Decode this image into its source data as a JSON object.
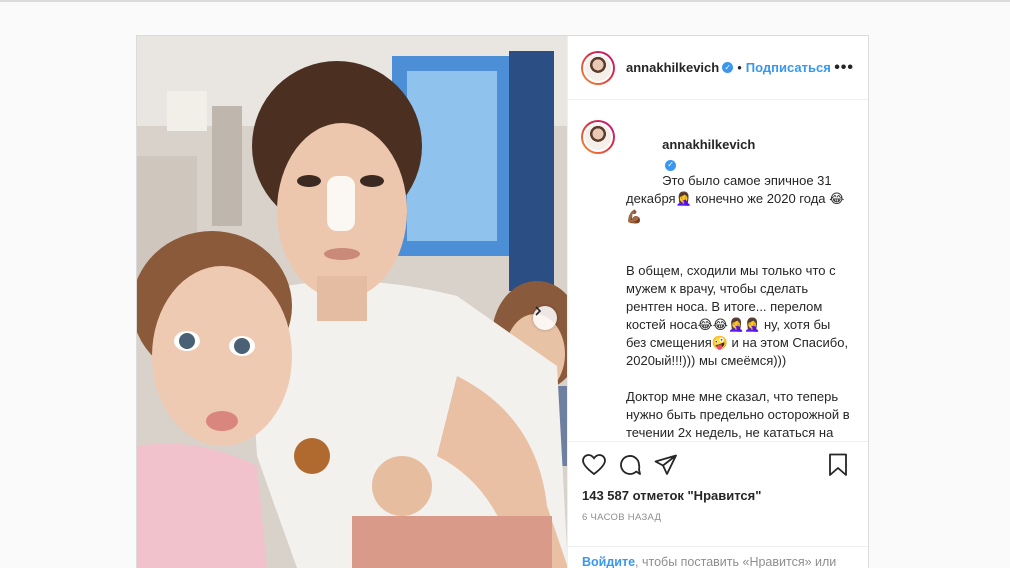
{
  "post": {
    "username": "annakhilkevich",
    "follow_label": "Подписаться",
    "more_label": "•••",
    "separator": "•",
    "caption_lines": [
      "Это было самое эпичное 31 декабря🤦‍♀️ конечно же 2020 года 😂💪🏾",
      "",
      "В общем, сходили мы только что с мужем к врачу, чтобы сделать рентген носа. В итоге... перелом костей носа😂😂🤦‍♀️🤦‍♀️ ну, хотя бы без смещения🤪 и на этом Спасибо, 2020ый!!!))) мы смеёмся)))",
      "",
      "Доктор мне мне сказал, что теперь нужно быть предельно осторожной в течении 2х недель, не кататься на коньках, тюбингах, не тереть нос, и тд🙈 ну и спать на спине, что очень сложно для меня😭 а если я не буду соблюдать меры, надломанная кость уедет в сторону, или провалиться😱 🤷‍♀️😂"
    ],
    "likes_text": "143 587 отметок \"Нравится\"",
    "time_text": "6 ЧАСОВ НАЗАД",
    "login_link": "Войдите",
    "login_text": ", чтобы поставить «Нравится» или"
  },
  "icons": [
    "heart-icon",
    "comment-icon",
    "share-icon",
    "bookmark-icon",
    "verified-badge-icon",
    "chevron-right-icon"
  ],
  "colors": {
    "accent": "#3897f0",
    "text": "#262626",
    "muted": "#8e8e8e",
    "border": "#dbdbdb"
  }
}
